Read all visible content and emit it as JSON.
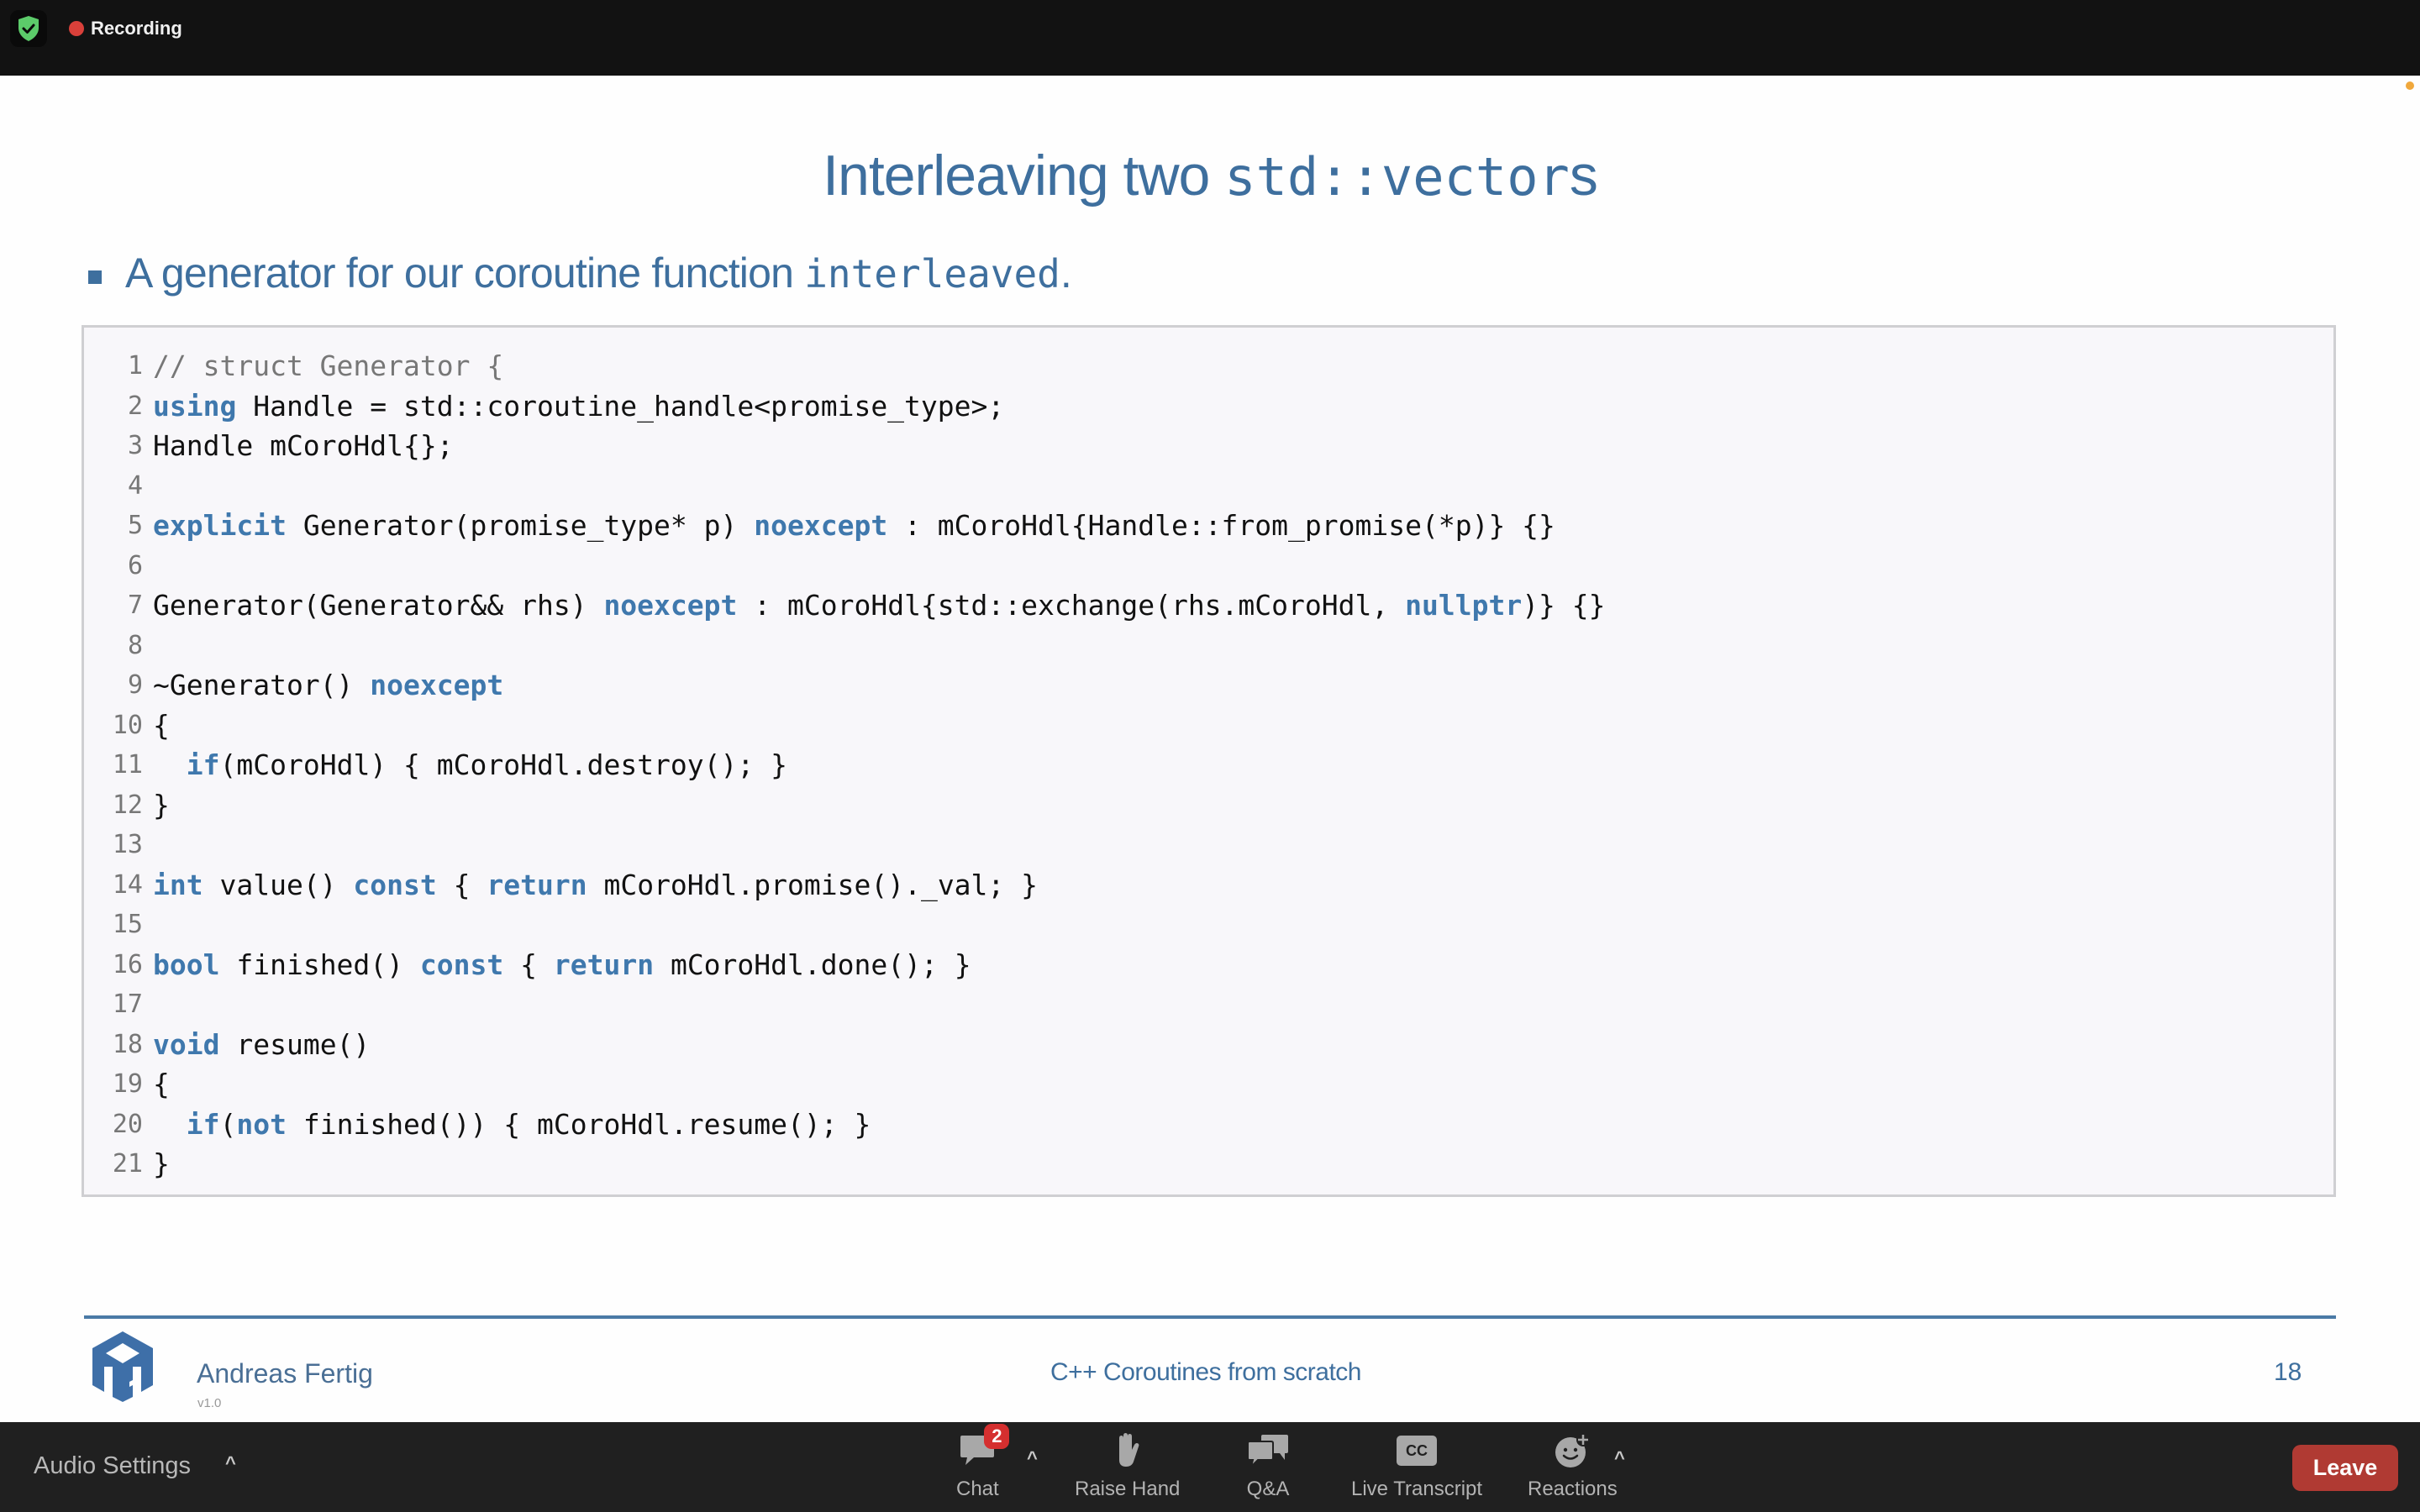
{
  "topbar": {
    "recording_label": "Recording",
    "security_icon": "shield-check-icon",
    "recording_color": "#d9403a"
  },
  "slide": {
    "title_text": "Interleaving two ",
    "title_code": "std::vector",
    "title_suffix": "s",
    "bullet_text": "A generator for our coroutine function ",
    "bullet_code": "interleaved",
    "bullet_suffix": ".",
    "accent_color": "#3e6f9e",
    "code_lines": [
      {
        "n": "1",
        "tokens": [
          {
            "t": "// struct Generator {",
            "c": "cm"
          }
        ]
      },
      {
        "n": "2",
        "tokens": [
          {
            "t": "using",
            "c": "kw"
          },
          {
            "t": " Handle = std::coroutine_handle<promise_type>;",
            "c": ""
          }
        ]
      },
      {
        "n": "3",
        "tokens": [
          {
            "t": "Handle mCoroHdl{};",
            "c": ""
          }
        ]
      },
      {
        "n": "4",
        "tokens": []
      },
      {
        "n": "5",
        "tokens": [
          {
            "t": "explicit",
            "c": "kw"
          },
          {
            "t": " Generator(promise_type* p) ",
            "c": ""
          },
          {
            "t": "noexcept",
            "c": "kw"
          },
          {
            "t": " : mCoroHdl{Handle::from_promise(*p)} {}",
            "c": ""
          }
        ]
      },
      {
        "n": "6",
        "tokens": []
      },
      {
        "n": "7",
        "tokens": [
          {
            "t": "Generator(Generator&& rhs) ",
            "c": ""
          },
          {
            "t": "noexcept",
            "c": "kw"
          },
          {
            "t": " : mCoroHdl{std::exchange(rhs.mCoroHdl, ",
            "c": ""
          },
          {
            "t": "nullptr",
            "c": "kw"
          },
          {
            "t": ")} {}",
            "c": ""
          }
        ]
      },
      {
        "n": "8",
        "tokens": []
      },
      {
        "n": "9",
        "tokens": [
          {
            "t": "~Generator() ",
            "c": ""
          },
          {
            "t": "noexcept",
            "c": "kw"
          }
        ]
      },
      {
        "n": "10",
        "tokens": [
          {
            "t": "{",
            "c": ""
          }
        ]
      },
      {
        "n": "11",
        "tokens": [
          {
            "t": "  ",
            "c": ""
          },
          {
            "t": "if",
            "c": "kw"
          },
          {
            "t": "(mCoroHdl) { mCoroHdl.destroy(); }",
            "c": ""
          }
        ]
      },
      {
        "n": "12",
        "tokens": [
          {
            "t": "}",
            "c": ""
          }
        ]
      },
      {
        "n": "13",
        "tokens": []
      },
      {
        "n": "14",
        "tokens": [
          {
            "t": "int",
            "c": "kw"
          },
          {
            "t": " value() ",
            "c": ""
          },
          {
            "t": "const",
            "c": "kw"
          },
          {
            "t": " { ",
            "c": ""
          },
          {
            "t": "return",
            "c": "kw"
          },
          {
            "t": " mCoroHdl.promise()._val; }",
            "c": ""
          }
        ]
      },
      {
        "n": "15",
        "tokens": []
      },
      {
        "n": "16",
        "tokens": [
          {
            "t": "bool",
            "c": "kw"
          },
          {
            "t": " finished() ",
            "c": ""
          },
          {
            "t": "const",
            "c": "kw"
          },
          {
            "t": " { ",
            "c": ""
          },
          {
            "t": "return",
            "c": "kw"
          },
          {
            "t": " mCoroHdl.done(); }",
            "c": ""
          }
        ]
      },
      {
        "n": "17",
        "tokens": []
      },
      {
        "n": "18",
        "tokens": [
          {
            "t": "void",
            "c": "kw"
          },
          {
            "t": " resume()",
            "c": ""
          }
        ]
      },
      {
        "n": "19",
        "tokens": [
          {
            "t": "{",
            "c": ""
          }
        ]
      },
      {
        "n": "20",
        "tokens": [
          {
            "t": "  ",
            "c": ""
          },
          {
            "t": "if",
            "c": "kw"
          },
          {
            "t": "(",
            "c": ""
          },
          {
            "t": "not",
            "c": "kw"
          },
          {
            "t": " finished()) { mCoroHdl.resume(); }",
            "c": ""
          }
        ]
      },
      {
        "n": "21",
        "tokens": [
          {
            "t": "}",
            "c": ""
          }
        ]
      }
    ],
    "footer": {
      "author": "Andreas Fertig",
      "version": "v1.0",
      "course": "C++ Coroutines from scratch",
      "page_number": "18",
      "logo_icon": "af-cube-logo-icon"
    }
  },
  "toolbar": {
    "audio_settings_label": "Audio Settings",
    "buttons": [
      {
        "label": "Chat",
        "icon": "chat-bubble-icon",
        "badge": "2"
      },
      {
        "label": "Raise Hand",
        "icon": "hand-icon"
      },
      {
        "label": "Q&A",
        "icon": "qa-bubbles-icon"
      },
      {
        "label": "Live Transcript",
        "icon": "cc-icon",
        "icon_text": "CC"
      },
      {
        "label": "Reactions",
        "icon": "smiley-plus-icon"
      }
    ],
    "leave_label": "Leave",
    "leave_color": "#b03a33"
  }
}
